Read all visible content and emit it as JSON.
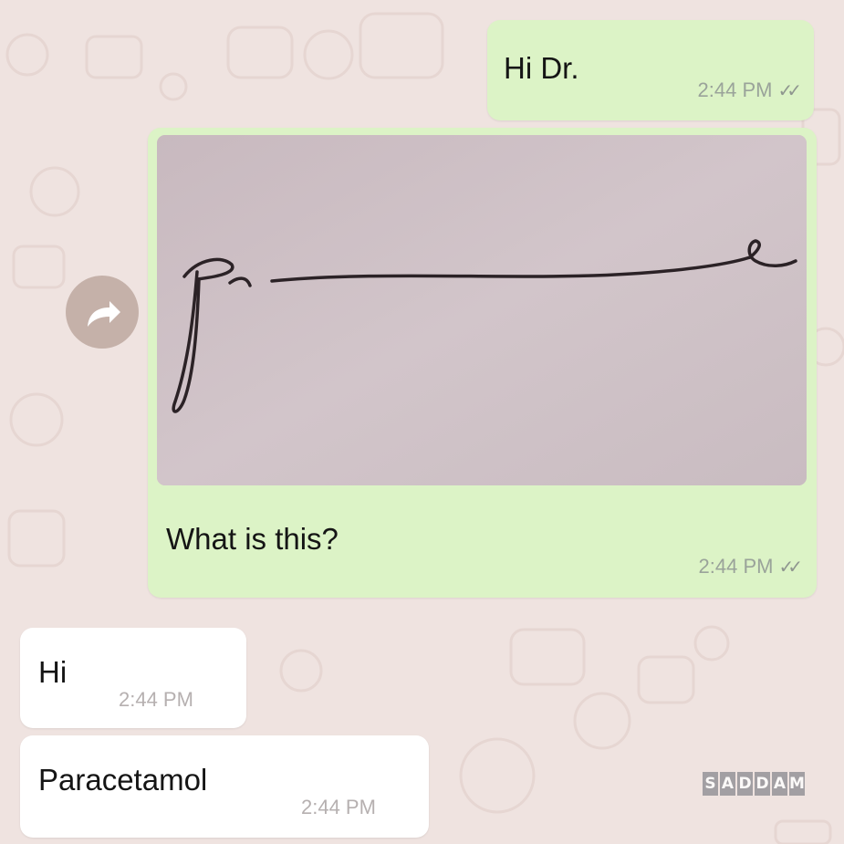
{
  "chat": {
    "messages": [
      {
        "direction": "outgoing",
        "text": "Hi Dr.",
        "time": "2:44 PM",
        "status": "read"
      },
      {
        "direction": "outgoing",
        "type": "image",
        "image_description": "handwritten-signature-scribble",
        "caption": "What is this?",
        "time": "2:44 PM",
        "status": "read"
      },
      {
        "direction": "incoming",
        "text": "Hi",
        "time": "2:44 PM"
      },
      {
        "direction": "incoming",
        "text": "Paracetamol",
        "time": "2:44 PM"
      }
    ],
    "read_ticks": "✓✓",
    "forward_icon": "forward-arrow-icon"
  },
  "watermark": {
    "text": "SADDAM",
    "chars": [
      "S",
      "A",
      "D",
      "D",
      "A",
      "M"
    ]
  },
  "colors": {
    "background": "#efe3e0",
    "outgoing_bubble": "#dcf3c6",
    "incoming_bubble": "#ffffff",
    "forward_button": "#c5b1a9",
    "timestamp": "#9aa39a"
  }
}
